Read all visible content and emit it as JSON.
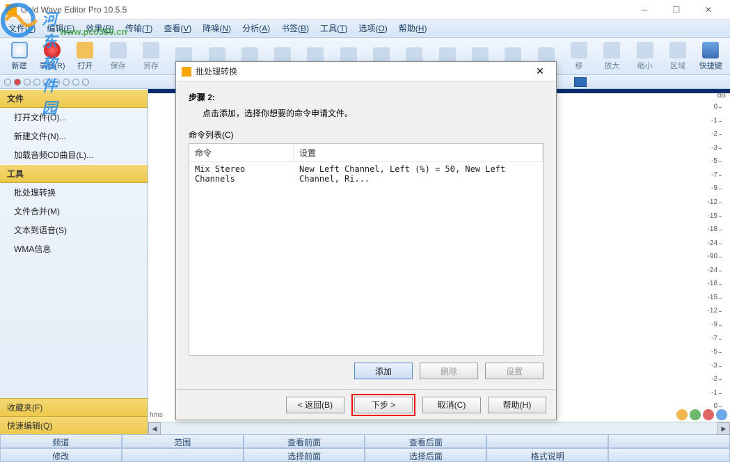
{
  "window": {
    "title": "Gold Wave Editor Pro 10.5.5"
  },
  "watermark": {
    "line1": "河东软件园",
    "line2": "www.pc0359.cn"
  },
  "menu": [
    {
      "label": "文件",
      "key": "F"
    },
    {
      "label": "编辑",
      "key": "E"
    },
    {
      "label": "效果",
      "key": "R"
    },
    {
      "label": "传输",
      "key": "T"
    },
    {
      "label": "查看",
      "key": "V"
    },
    {
      "label": "降噪",
      "key": "N"
    },
    {
      "label": "分析",
      "key": "A"
    },
    {
      "label": "书签",
      "key": "B"
    },
    {
      "label": "工具",
      "key": "T"
    },
    {
      "label": "选项",
      "key": "O"
    },
    {
      "label": "帮助",
      "key": "H"
    }
  ],
  "toolbar": [
    {
      "label": "新建",
      "name": "new",
      "active": true
    },
    {
      "label": "录音(R)",
      "name": "record",
      "active": true
    },
    {
      "label": "打开",
      "name": "open",
      "active": true
    },
    {
      "label": "保存",
      "name": "save"
    },
    {
      "label": "另存",
      "name": "saveas"
    },
    {
      "label": "",
      "name": "undo"
    },
    {
      "label": "",
      "name": "redo"
    },
    {
      "label": "",
      "name": "cut"
    },
    {
      "label": "",
      "name": "copy"
    },
    {
      "label": "",
      "name": "paste"
    },
    {
      "label": "",
      "name": "paste2"
    },
    {
      "label": "",
      "name": "delete"
    },
    {
      "label": "",
      "name": "crop"
    },
    {
      "label": "",
      "name": "marker1"
    },
    {
      "label": "",
      "name": "marker2"
    },
    {
      "label": "",
      "name": "marker3"
    },
    {
      "label": "",
      "name": "marker4"
    },
    {
      "label": "移",
      "name": "move"
    },
    {
      "label": "放大",
      "name": "zoomin"
    },
    {
      "label": "缩小",
      "name": "zoomout"
    },
    {
      "label": "区域",
      "name": "region"
    },
    {
      "label": "快捷键",
      "name": "hotkey",
      "active": true
    }
  ],
  "sidebar": {
    "files_header": "文件",
    "files": [
      "打开文件(O)...",
      "新建文件(N)...",
      "加载音频CD曲目(L)..."
    ],
    "tools_header": "工具",
    "tools": [
      "批处理转换",
      "文件合并(M)",
      "文本到语音(S)",
      "WMA信息"
    ],
    "fav": "收藏夹(F)",
    "quick": "快速编辑(Q)"
  },
  "ruler": {
    "unit": "dB",
    "hms": "hms",
    "ticks": [
      0,
      -1,
      -2,
      -3,
      -5,
      -7,
      -9,
      -12,
      -15,
      -18,
      -24,
      -90,
      -24,
      -18,
      -15,
      -12,
      -9,
      -7,
      -5,
      -3,
      -2,
      -1,
      0
    ]
  },
  "bottom": {
    "row1": [
      "频道",
      "范围",
      "查看前面",
      "查看后面",
      "",
      ""
    ],
    "row2": [
      "修改",
      "",
      "选择前面",
      "选择后面",
      "格式说明",
      ""
    ]
  },
  "dialog": {
    "title": "批处理转换",
    "step": "步骤 2:",
    "desc": "点击添加，选择你想要的命令申请文件。",
    "group": "命令列表(C)",
    "headers": {
      "cmd": "命令",
      "set": "设置"
    },
    "rows": [
      {
        "cmd": "Mix Stereo Channels",
        "set": "New Left Channel, Left (%) = 50, New Left Channel, Ri..."
      }
    ],
    "btn_add": "添加",
    "btn_del": "删除",
    "btn_set": "设置",
    "nav_back": "< 返回(B)",
    "nav_next": "下步 >",
    "nav_cancel": "取消(C)",
    "nav_help": "帮助(H)"
  }
}
